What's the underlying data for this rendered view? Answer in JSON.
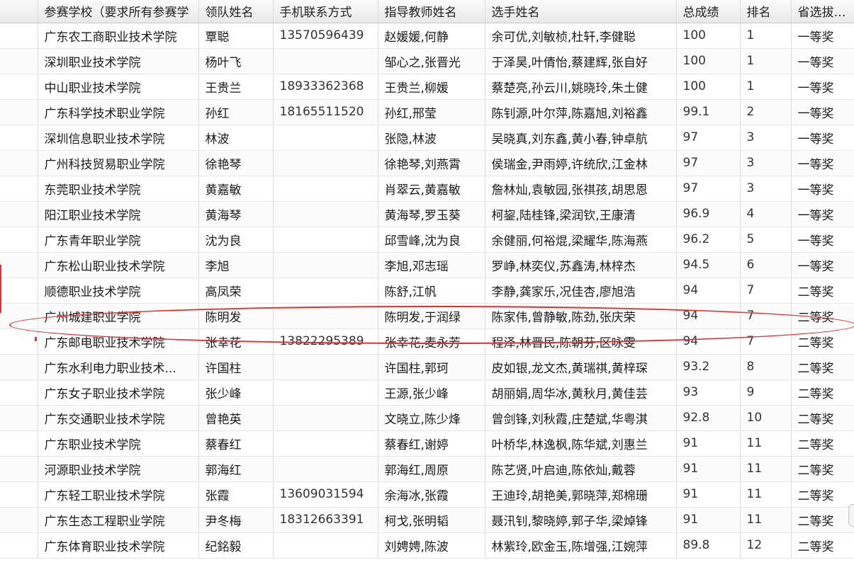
{
  "columns": [
    "",
    "参赛学校（要求所有参赛学",
    "领队姓名",
    "手机联系方式",
    "指导教师姓名",
    "选手姓名",
    "总成绩",
    "排名",
    "省选拔赛排"
  ],
  "rows": [
    [
      "广东农工商职业技术学院",
      "覃聪",
      "13570596439",
      "赵媛媛,何静",
      "余可优,刘敏桢,杜轩,李健聪",
      "100",
      "1",
      "一等奖"
    ],
    [
      "深圳职业技术学院",
      "杨叶飞",
      "",
      "邹心之,张晋光",
      "于泽昊,叶倩怡,蔡建辉,张自好",
      "100",
      "1",
      "一等奖"
    ],
    [
      "中山职业技术学院",
      "王贵兰",
      "18933362368",
      "王贵兰,柳媛",
      "蔡楚亮,孙云川,姚晓玲,朱土健",
      "100",
      "1",
      "一等奖"
    ],
    [
      "广东科学技术职业学院",
      "孙红",
      "18165511520",
      "孙红,邢莹",
      "陈钊源,叶尔萍,陈嘉旭,刘裕鑫",
      "99.1",
      "2",
      "一等奖"
    ],
    [
      "深圳信息职业技术学院",
      "林波",
      "",
      "张隐,林波",
      "吴晓真,刘东鑫,黄小春,钟卓航",
      "97",
      "3",
      "一等奖"
    ],
    [
      "广州科技贸易职业学院",
      "徐艳琴",
      "",
      "徐艳琴,刘燕霄",
      "侯瑞金,尹雨婷,许统欣,江金林",
      "97",
      "3",
      "一等奖"
    ],
    [
      "东莞职业技术学院",
      "黄嘉敏",
      "",
      "肖翠云,黄嘉敏",
      "詹林灿,袁敏园,张祺孩,胡思恩",
      "97",
      "3",
      "一等奖"
    ],
    [
      "阳江职业技术学院",
      "黄海琴",
      "",
      "黄海琴,罗玉葵",
      "柯鋆,陆桂锋,梁润钦,王康清",
      "96.9",
      "4",
      "一等奖"
    ],
    [
      "广东青年职业学院",
      "沈为良",
      "",
      "邱雪峰,沈为良",
      "余健丽,何裕焜,梁耀华,陈海燕",
      "96.2",
      "5",
      "一等奖"
    ],
    [
      "广东松山职业技术学院",
      "李旭",
      "",
      "李旭,邓志瑶",
      "罗峥,林奕仪,苏鑫涛,林梓杰",
      "94.5",
      "6",
      "一等奖"
    ],
    [
      "顺德职业技术学院",
      "高凤荣",
      "",
      "陈舒,江帆",
      "李静,龚家乐,况佳杏,廖旭浩",
      "94",
      "7",
      "二等奖"
    ],
    [
      "广州城建职业学院",
      "陈明发",
      "",
      "陈明发,于润绿",
      "陈家伟,曾静敏,陈劲,张庆荣",
      "94",
      "7",
      "二等奖"
    ],
    [
      "广东邮电职业技术学院",
      "张幸花",
      "13822295389",
      "张幸花,麦永芳",
      "程泽,林晋民,陈朝芬,区咏雯",
      "94",
      "7",
      "二等奖"
    ],
    [
      "广东水利电力职业技术...",
      "许国柱",
      "",
      "许国柱,郭珂",
      "皮如银,龙文杰,黄瑞祺,黄梓琛",
      "93.2",
      "8",
      "二等奖"
    ],
    [
      "广东女子职业技术学院",
      "张少峰",
      "",
      "王源,张少峰",
      "胡丽娟,周华冰,黄秋月,黄佳芸",
      "93",
      "9",
      "二等奖"
    ],
    [
      "广东交通职业技术学院",
      "曾艳英",
      "",
      "文晓立,陈少烽",
      "曾剑锋,刘秋霞,庄楚斌,华粤淇",
      "92.8",
      "10",
      "二等奖"
    ],
    [
      "广东职业技术学院",
      "蔡春红",
      "",
      "蔡春红,谢婷",
      "叶桥华,林逸枫,陈华斌,刘惠兰",
      "91",
      "11",
      "二等奖"
    ],
    [
      "河源职业技术学院",
      "郭海红",
      "",
      "郭海红,周原",
      "陈艺贤,叶启迪,陈依灿,戴蓉",
      "91",
      "11",
      "二等奖"
    ],
    [
      "广东轻工职业技术学院",
      "张霞",
      "13609031594",
      "余海冰,张霞",
      "王迪玲,胡艳美,郭晓萍,郑棉珊",
      "91",
      "11",
      "二等奖"
    ],
    [
      "广东生态工程职业学院",
      "尹冬梅",
      "18312663391",
      "柯戈,张明韬",
      "聂汛钊,黎晓婷,郭子华,梁焯锋",
      "91",
      "11",
      "二等奖"
    ],
    [
      "广东体育职业技术学院",
      "纪銘毅",
      "",
      "刘娉娉,陈波",
      "林紫玲,欧金玉,陈增强,江婉萍",
      "89.8",
      "12",
      "二等奖"
    ]
  ],
  "annotation": {
    "highlight_color": "#e03030"
  }
}
